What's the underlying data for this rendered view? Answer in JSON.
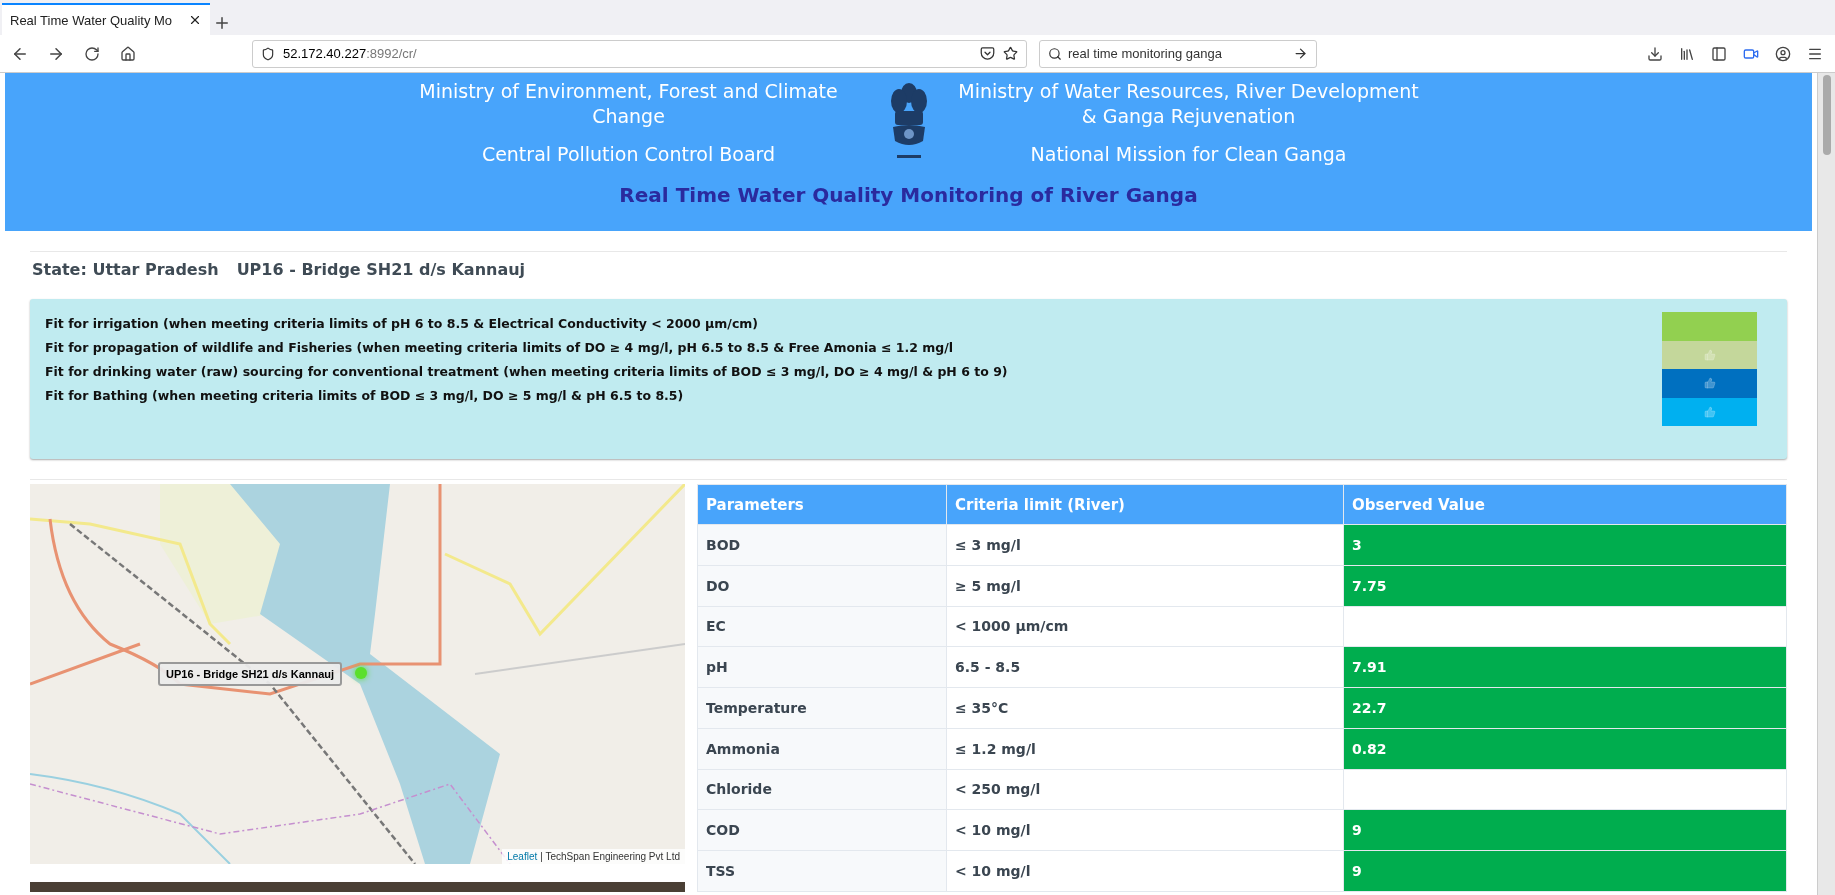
{
  "browser": {
    "tab": {
      "title": "Real Time Water Quality Mo",
      "selected": true
    },
    "url_host": "52.172.40.227",
    "url_path": ":8992/cr/",
    "search": {
      "value": "real time monitoring ganga"
    }
  },
  "header": {
    "left": [
      "Ministry of Environment, Forest and Climate Change",
      "Central Pollution Control Board"
    ],
    "right": [
      "Ministry of Water Resources, River Development & Ganga Rejuvenation",
      "National Mission for Clean Ganga"
    ],
    "title": "Real Time Water Quality Monitoring of River Ganga"
  },
  "station": {
    "state": "State: Uttar Pradesh",
    "name": "UP16 - Bridge SH21 d/s Kannauj"
  },
  "criteria": [
    {
      "text": "Fit for irrigation (when meeting criteria limits of pH 6 to 8.5 & Electrical Conductivity < 2000 µm/cm)",
      "color": "#92d050",
      "thumb": false
    },
    {
      "text": "Fit for propagation of wildlife and Fisheries (when meeting criteria limits of DO ≥ 4 mg/l, pH 6.5 to 8.5 & Free Amonia ≤ 1.2 mg/l",
      "color": "#c4d79b",
      "thumb": true
    },
    {
      "text": "Fit for drinking water (raw) sourcing for conventional treatment (when meeting criteria limits of BOD ≤ 3 mg/l, DO ≥ 4 mg/l & pH 6 to 9)",
      "color": "#0070c0",
      "thumb": true
    },
    {
      "text": "Fit for Bathing (when meeting criteria limits of BOD ≤ 3 mg/l, DO ≥ 5 mg/l & pH 6.5 to 8.5)",
      "color": "#00b0f0",
      "thumb": true
    }
  ],
  "map": {
    "kind": "picture",
    "marker_label": "UP16 - Bridge SH21 d/s Kannauj",
    "attribution_link": "Leaflet",
    "attribution": "| TechSpan Engineering Pvt Ltd"
  },
  "table": {
    "columns": [
      "Parameters",
      "Criteria limit (River)",
      "Observed Value"
    ],
    "rows": [
      {
        "parameter": "BOD",
        "limit": "≤ 3 mg/l",
        "observed": "3"
      },
      {
        "parameter": "DO",
        "limit": "≥ 5 mg/l",
        "observed": "7.75"
      },
      {
        "parameter": "EC",
        "limit": "< 1000 µm/cm"
      },
      {
        "parameter": "pH",
        "limit": "6.5 - 8.5",
        "observed": "7.91"
      },
      {
        "parameter": "Temperature",
        "limit": "≤ 35°C",
        "observed": "22.7"
      },
      {
        "parameter": "Ammonia",
        "limit": "≤ 1.2 mg/l",
        "observed": "0.82"
      },
      {
        "parameter": "Chloride",
        "limit": "< 250 mg/l"
      },
      {
        "parameter": "COD",
        "limit": "< 10 mg/l",
        "observed": "9"
      },
      {
        "parameter": "TSS",
        "limit": "< 10 mg/l",
        "observed": "9"
      }
    ]
  }
}
